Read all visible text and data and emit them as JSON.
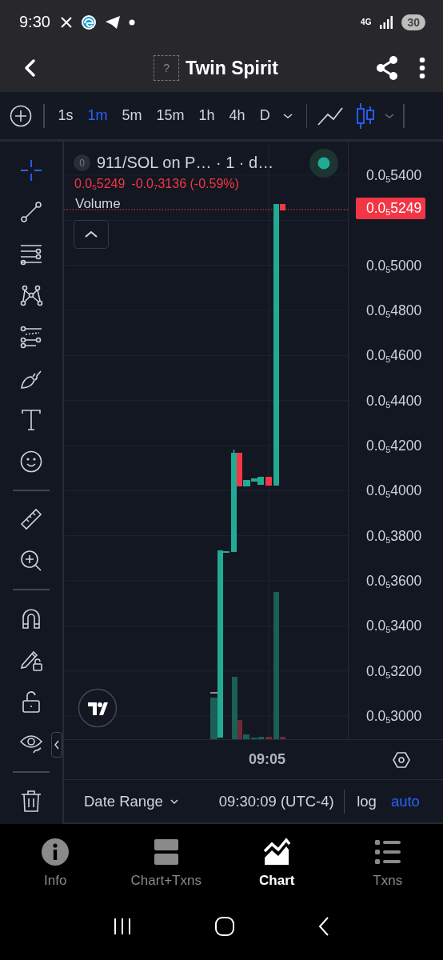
{
  "status_bar": {
    "time": "9:30",
    "network": "4G",
    "battery": "30"
  },
  "header": {
    "token_placeholder": "?",
    "title": "Twin Spirit"
  },
  "toolbar": {
    "timeframes": [
      {
        "label": "1s",
        "selected": false
      },
      {
        "label": "1m",
        "selected": true
      },
      {
        "label": "5m",
        "selected": false
      },
      {
        "label": "15m",
        "selected": false
      },
      {
        "label": "1h",
        "selected": false
      },
      {
        "label": "4h",
        "selected": false
      },
      {
        "label": "D",
        "selected": false
      }
    ],
    "chart_types": [
      {
        "kind": "line",
        "selected": false
      },
      {
        "kind": "candles",
        "selected": true
      }
    ]
  },
  "drawing_tools": [
    [
      {
        "kind": "crosshair",
        "selected": true
      },
      {
        "kind": "trend-line",
        "selected": false
      },
      {
        "kind": "lines",
        "selected": false
      },
      {
        "kind": "pattern",
        "selected": false
      },
      {
        "kind": "fib",
        "selected": false
      },
      {
        "kind": "brush",
        "selected": false
      },
      {
        "kind": "text",
        "selected": false
      },
      {
        "kind": "emoji",
        "selected": false
      }
    ],
    [
      {
        "kind": "ruler",
        "selected": false
      },
      {
        "kind": "zoom",
        "selected": false
      }
    ],
    [
      {
        "kind": "magnet",
        "selected": false
      },
      {
        "kind": "lock-drawing",
        "selected": false
      },
      {
        "kind": "unlock",
        "selected": false
      },
      {
        "kind": "eye",
        "selected": false
      }
    ],
    [
      {
        "kind": "trash",
        "selected": false
      }
    ]
  ],
  "legend": {
    "badge": "0",
    "symbol": "911/SOL on P… · 1 · d…",
    "last": "0.0$_{5}$5249",
    "change": "-0.0$_{7}$3136 (-0.59%)",
    "indicator": "Volume"
  },
  "price_axis": {
    "upper_labels": [
      "0.0$_{5}$5400"
    ],
    "current_price": "0.0$_{5}$5249",
    "lower_labels": [
      "0.0$_{5}$5000",
      "0.0$_{5}$4800",
      "0.0$_{5}$4600",
      "0.0$_{5}$4400",
      "0.0$_{5}$4200",
      "0.0$_{5}$4000",
      "0.0$_{5}$3800",
      "0.0$_{5}$3600",
      "0.0$_{5}$3400",
      "0.0$_{5}$3200",
      "0.0$_{5}$3000"
    ]
  },
  "time_axis": {
    "label": "09:05"
  },
  "bottom_bar": {
    "date_range": "Date Range",
    "clock": "09:30:09 (UTC-4)",
    "scales": [
      {
        "label": "log",
        "selected": false
      },
      {
        "label": "auto",
        "selected": true
      }
    ]
  },
  "tabs": [
    {
      "kind": "info",
      "label": "Info",
      "selected": false
    },
    {
      "kind": "split",
      "label": "Chart+Txns",
      "selected": false
    },
    {
      "kind": "chart",
      "label": "Chart",
      "selected": true
    },
    {
      "kind": "list",
      "label": "Txns",
      "selected": false
    }
  ]
}
